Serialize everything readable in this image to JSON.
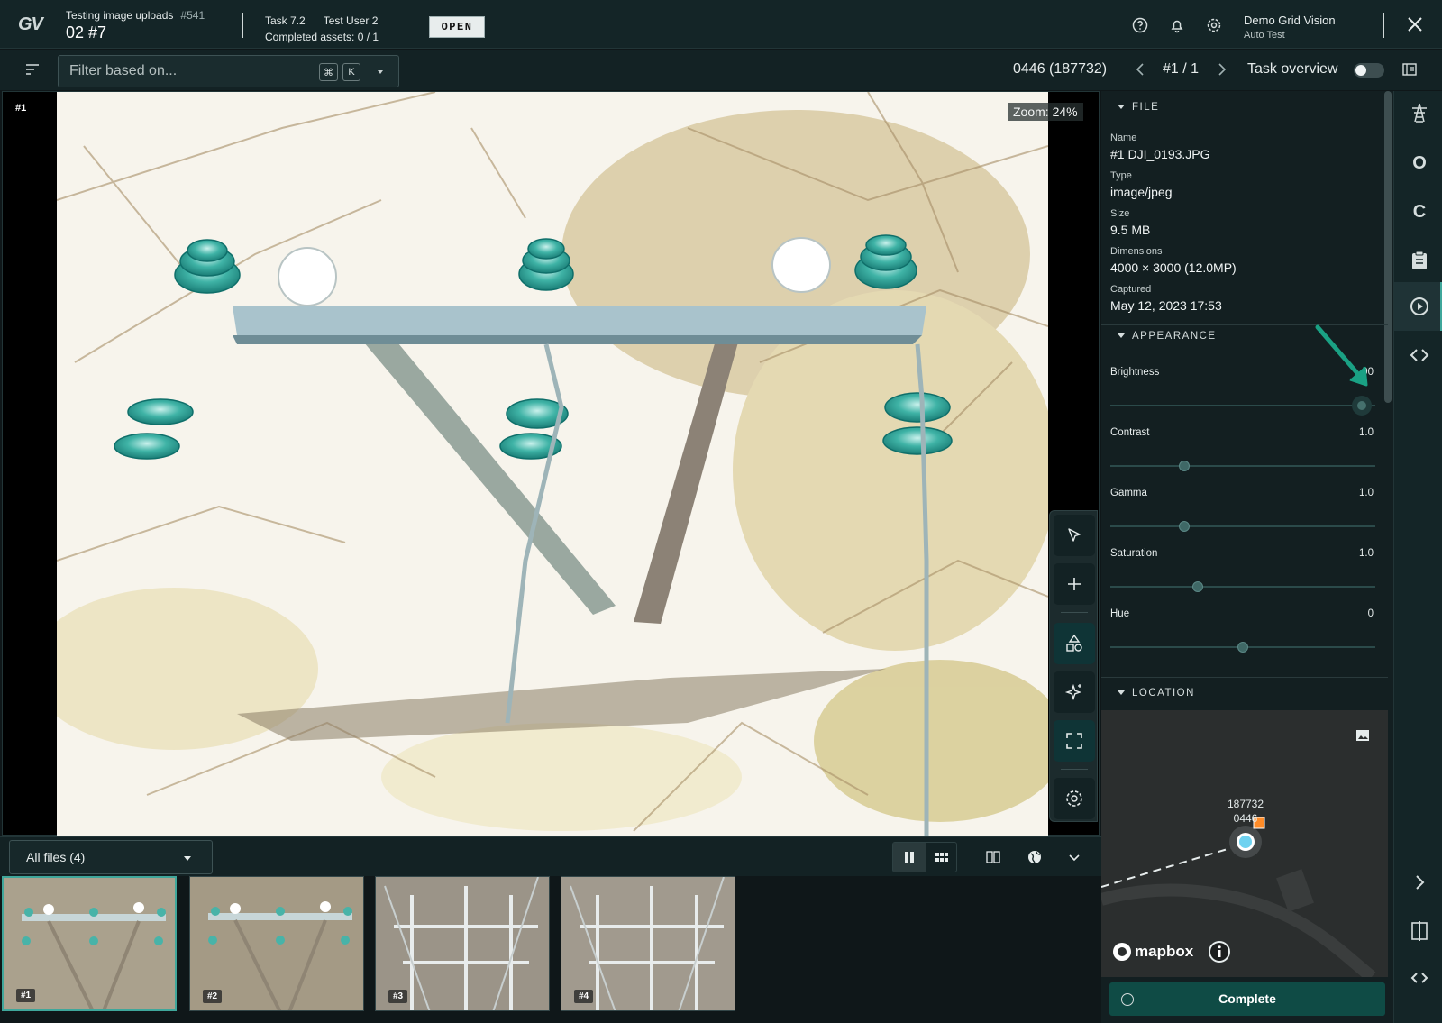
{
  "header": {
    "logo": "GV",
    "project_title": "Testing image uploads",
    "project_number": "#541",
    "asset_line": "02 #7",
    "task_label": "Task 7.2",
    "task_user": "Test User 2",
    "completed_assets": "Completed assets: 0 / 1",
    "status_badge": "OPEN",
    "org_name": "Demo Grid Vision",
    "org_user": "Auto Test",
    "icons": [
      "help-icon",
      "bell-icon",
      "gear-icon",
      "close-icon"
    ]
  },
  "toolbar": {
    "filter_placeholder": "Filter based on...",
    "shortcut_cmd": "⌘",
    "shortcut_key": "K",
    "asset_id": "0446 (187732)",
    "pager": "#1 / 1",
    "task_overview_label": "Task overview",
    "task_overview_on": false
  },
  "viewer": {
    "image_number": "#1",
    "zoom_label": "Zoom: 24%",
    "tools": [
      "select-tool-icon",
      "add-icon",
      "shapes-icon",
      "ai-sparkle-icon",
      "fullscreen-icon",
      "settings-icon"
    ]
  },
  "filmstrip": {
    "filter_label": "All files (4)",
    "thumbnails": [
      {
        "tag": "#1",
        "selected": true
      },
      {
        "tag": "#2",
        "selected": false
      },
      {
        "tag": "#3",
        "selected": false
      },
      {
        "tag": "#4",
        "selected": false
      }
    ]
  },
  "file_section": {
    "title": "FILE",
    "name_label": "Name",
    "name_value": "#1 DJI_0193.JPG",
    "type_label": "Type",
    "type_value": "image/jpeg",
    "size_label": "Size",
    "size_value": "9.5 MB",
    "dims_label": "Dimensions",
    "dims_value": "4000 × 3000 (12.0MP)",
    "captured_label": "Captured",
    "captured_value": "May 12, 2023 17:53"
  },
  "appearance": {
    "title": "APPEARANCE",
    "sliders": [
      {
        "label": "Brightness",
        "value": "90",
        "fraction": 0.95
      },
      {
        "label": "Contrast",
        "value": "1.0",
        "fraction": 0.28
      },
      {
        "label": "Gamma",
        "value": "1.0",
        "fraction": 0.28
      },
      {
        "label": "Saturation",
        "value": "1.0",
        "fraction": 0.33
      },
      {
        "label": "Hue",
        "value": "0",
        "fraction": 0.5
      }
    ]
  },
  "location": {
    "title": "LOCATION",
    "marker_line1": "187732",
    "marker_line2": "0446",
    "attribution": "mapbox"
  },
  "actions": {
    "complete_label": "Complete"
  },
  "rail": {
    "letters": [
      "O",
      "C"
    ]
  },
  "colors": {
    "accent": "#3fa79b",
    "header_bg": "#142527",
    "complete_bg": "#0f4b45",
    "marker_blue": "#6fd2f0",
    "marker_orange": "#ff8c28"
  }
}
